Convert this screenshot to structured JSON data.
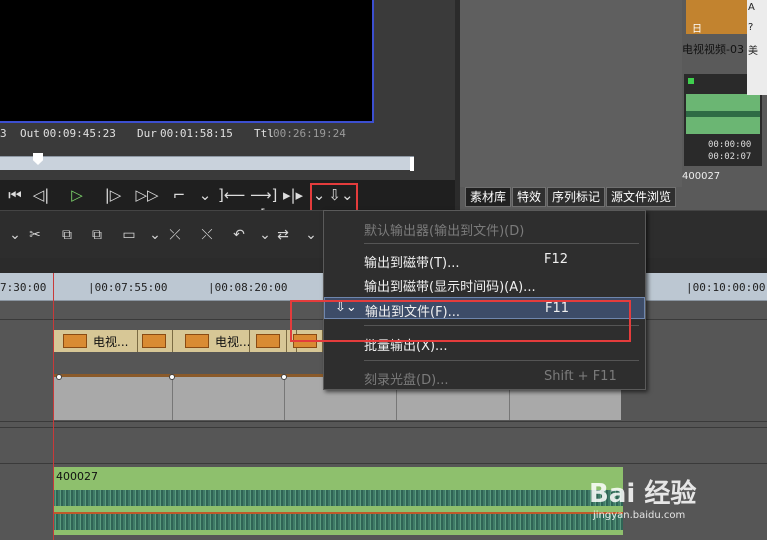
{
  "player": {
    "timecodes": {
      "in_partial": "3",
      "out_label": "Out",
      "out_value": "00:09:45:23",
      "dur_label": "Dur",
      "dur_value": "00:01:58:15",
      "ttl_label": "Ttl",
      "ttl_value": "00:26:19:24"
    },
    "transport_buttons": [
      "⏮",
      "◁|",
      "▷",
      "|▷",
      "▷▷",
      "⌐",
      "⌄",
      "]⟵",
      "⟶][",
      "▸|▸",
      "⌄",
      "⇩⌄"
    ],
    "transport_names": [
      "rewind-icon",
      "step-back-icon",
      "play-icon",
      "step-forward-icon",
      "fast-forward-icon",
      "loop-icon",
      "loop-dropdown-icon",
      "mark-in-icon",
      "mark-out-icon",
      "match-frame-icon",
      "match-frame-dropdown-icon",
      "export-icon"
    ]
  },
  "library": {
    "thumb1_day": "日",
    "thumb1_label": "电视视频-03",
    "audio_tc1": "00:00:00",
    "audio_tc2": "00:02:07",
    "audio_label": "400027",
    "side_labels": [
      "A",
      "?",
      "美"
    ],
    "tabs": [
      "素材库",
      "特效",
      "序列标记",
      "源文件浏览"
    ]
  },
  "timeline_toolbar": {
    "icons": [
      "⌄",
      "✂",
      "⧉",
      "⧉",
      "▭",
      "⌄",
      "⤫",
      "⤬",
      "↶",
      "⌄",
      "⇄",
      "⌄"
    ],
    "icon_names": [
      "toolbar-dropdown-icon",
      "cut-icon",
      "copy-icon",
      "paste-icon",
      "group-icon",
      "group-dropdown-icon",
      "delete-icon",
      "ripple-delete-icon",
      "undo-icon",
      "undo-dropdown-icon",
      "swap-icon",
      "swap-dropdown-icon"
    ]
  },
  "ruler": {
    "labels": [
      "7:30:00",
      "|00:07:55:00",
      "|00:08:20:00",
      "|00:10:00:00"
    ]
  },
  "tracks": {
    "video_clip_name": "电视...",
    "audio_clip_name": "400027"
  },
  "menu": {
    "items": [
      {
        "label": "默认输出器(输出到文件)(D)",
        "shortcut": "",
        "disabled": true
      },
      {
        "label": "输出到磁带(T)...",
        "shortcut": "F12",
        "disabled": false
      },
      {
        "label": "输出到磁带(显示时间码)(A)...",
        "shortcut": "",
        "disabled": false
      },
      {
        "label": "输出到文件(F)...",
        "shortcut": "F11",
        "disabled": false,
        "selected": true
      },
      {
        "label": "批量输出(X)...",
        "shortcut": "",
        "disabled": false
      },
      {
        "label": "刻录光盘(D)...",
        "shortcut": "Shift + F11",
        "disabled": true
      }
    ]
  },
  "watermark": {
    "text": "Bai 经验",
    "sub": "jingyan.baidu.com"
  }
}
